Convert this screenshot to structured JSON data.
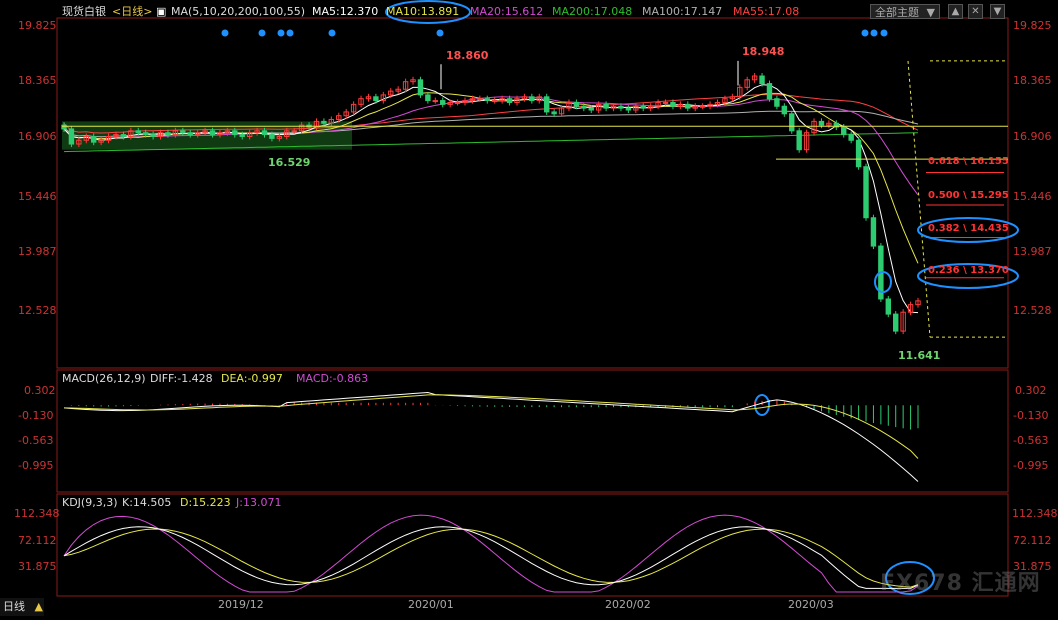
{
  "header": {
    "symbol": "现货白银",
    "period": "<日线>",
    "ma_params": "MA(5,10,20,200,100,55)",
    "ma5": "MA5:12.370",
    "ma10": "MA10:13.891",
    "ma20": "MA20:15.612",
    "ma200": "MA200:17.048",
    "ma100": "MA100:17.147",
    "ma55": "MA55:17.08",
    "menu_label": "全部主题",
    "menu_icon": "triangle-down-icon",
    "btn_up": "▲",
    "btn_close": "✕",
    "btn_down": "▼"
  },
  "macd_header": {
    "name": "MACD(26,12,9)",
    "diff": "DIFF:-1.428",
    "dea": "DEA:-0.997",
    "macd": "MACD:-0.863"
  },
  "kdj_header": {
    "name": "KDJ(9,3,3)",
    "k": "K:14.505",
    "d": "D:15.223",
    "j": "J:13.071"
  },
  "footer": {
    "period_tab": "日线",
    "tab_icon": "▲",
    "watermark": "FX678 汇通网"
  },
  "colors": {
    "up": "#ff3b3b",
    "down": "#2ecc71",
    "ma5": "#ffffff",
    "ma10": "#e6e64a",
    "ma20": "#d24bd2",
    "ma200": "#2ebd2e",
    "ma100": "#b0b0b0",
    "ma55": "#ff4040",
    "highlight": "#1e90ff"
  },
  "chart_data": [
    {
      "type": "candlestick",
      "title": "现货白银 日线",
      "y_ticks": [
        "19.825",
        "18.365",
        "16.906",
        "15.446",
        "13.987",
        "12.528"
      ],
      "ylim": [
        11.3,
        19.9
      ],
      "x_ticks": [
        "2019/12",
        "2020/01",
        "2020/02",
        "2020/03"
      ],
      "annotations": {
        "high_1": "18.860",
        "high_2": "18.948",
        "low_1": "16.529",
        "low_2": "11.641"
      },
      "fib_levels": [
        {
          "label": "0.618 \\ 16.155",
          "value": 16.155
        },
        {
          "label": "0.500 \\ 15.295",
          "value": 15.295
        },
        {
          "label": "0.382 \\ 14.435",
          "value": 14.435
        },
        {
          "label": "0.236 \\ 13.370",
          "value": 13.37
        }
      ],
      "close": [
        17.15,
        16.75,
        16.85,
        16.95,
        16.8,
        16.85,
        16.95,
        17.0,
        16.95,
        17.1,
        17.05,
        17.0,
        16.95,
        17.05,
        17.0,
        17.1,
        17.05,
        17.0,
        17.05,
        17.1,
        17.0,
        17.05,
        17.1,
        17.0,
        16.95,
        17.05,
        17.1,
        17.0,
        16.9,
        16.95,
        17.1,
        17.1,
        17.25,
        17.2,
        17.35,
        17.3,
        17.4,
        17.5,
        17.6,
        17.8,
        17.95,
        18.0,
        17.9,
        18.05,
        18.15,
        18.2,
        18.4,
        18.45,
        18.05,
        17.9,
        17.9,
        17.8,
        17.85,
        17.85,
        17.9,
        17.95,
        17.95,
        17.9,
        17.9,
        17.95,
        17.85,
        17.95,
        18.0,
        17.9,
        18.0,
        17.6,
        17.55,
        17.7,
        17.85,
        17.75,
        17.7,
        17.65,
        17.8,
        17.7,
        17.75,
        17.7,
        17.65,
        17.75,
        17.7,
        17.75,
        17.85,
        17.85,
        17.75,
        17.8,
        17.7,
        17.75,
        17.75,
        17.8,
        17.85,
        17.95,
        18.0,
        18.25,
        18.45,
        18.55,
        18.35,
        17.95,
        17.75,
        17.55,
        17.1,
        16.6,
        17.05,
        17.35,
        17.25,
        17.3,
        17.2,
        17.0,
        16.85,
        16.15,
        14.8,
        14.05,
        12.65,
        12.25,
        11.8,
        12.3,
        12.5,
        12.6
      ],
      "ma_series": [
        "MA5",
        "MA10",
        "MA20",
        "MA200",
        "MA100",
        "MA55"
      ]
    },
    {
      "type": "macd",
      "y_ticks": [
        "0.302",
        "-0.130",
        "-0.563",
        "-0.995"
      ],
      "ylim": [
        -1.55,
        0.38
      ],
      "diff_last": -1.428,
      "dea_last": -0.997,
      "macd_last": -0.863
    },
    {
      "type": "kdj",
      "y_ticks": [
        "112.348",
        "72.112",
        "31.875"
      ],
      "ylim": [
        5,
        125
      ],
      "k_last": 14.505,
      "d_last": 15.223,
      "j_last": 13.071
    }
  ]
}
